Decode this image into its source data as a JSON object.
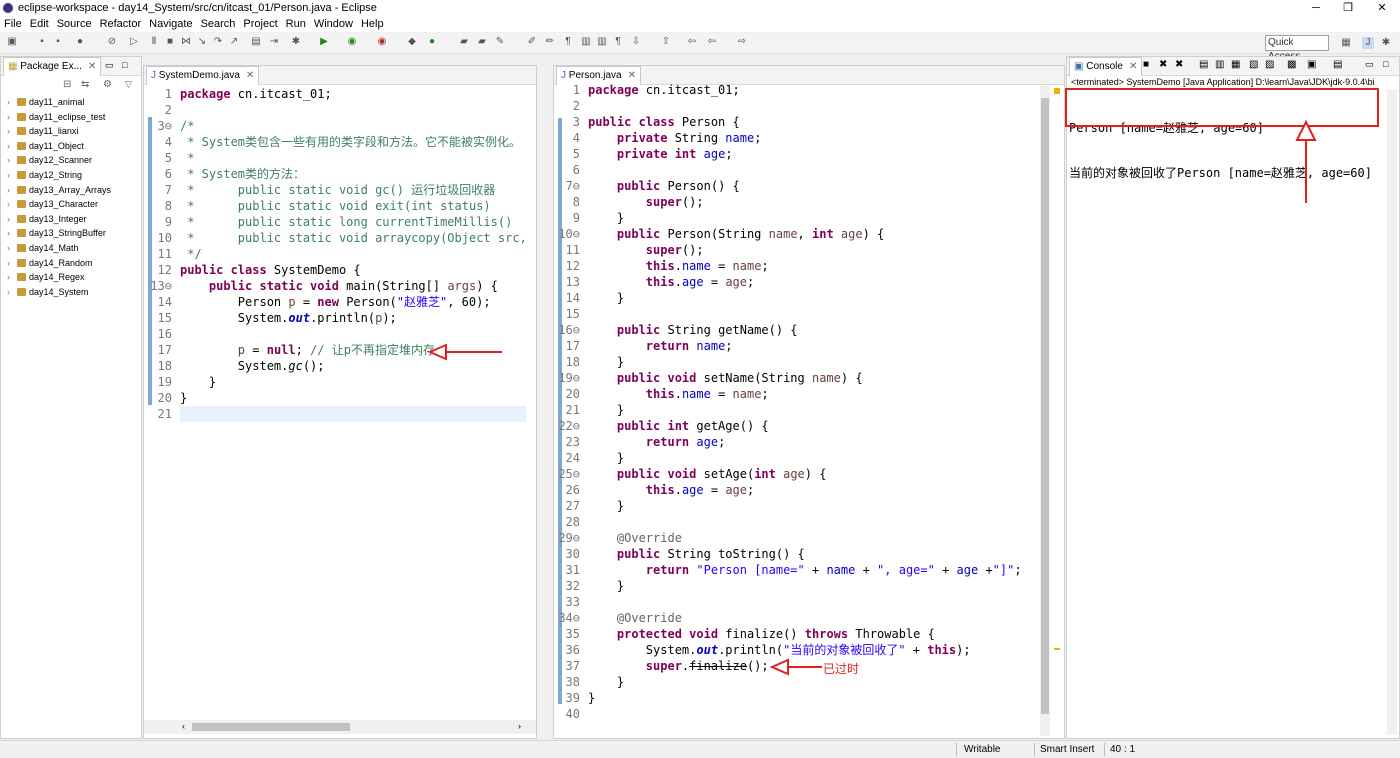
{
  "window": {
    "title": "eclipse-workspace - day14_System/src/cn/itcast_01/Person.java - Eclipse",
    "minimize": "─",
    "maximize": "❐",
    "close": "✕"
  },
  "menu": [
    "File",
    "Edit",
    "Source",
    "Refactor",
    "Navigate",
    "Search",
    "Project",
    "Run",
    "Window",
    "Help"
  ],
  "toolbar": {
    "quick_access_placeholder": "Quick Access"
  },
  "package_explorer": {
    "tab_label": "Package Ex...",
    "projects": [
      "day11_animal",
      "day11_eclipse_test",
      "day11_lianxi",
      "day11_Object",
      "day12_Scanner",
      "day12_String",
      "day13_Array_Arrays",
      "day13_Character",
      "day13_Integer",
      "day13_StringBuffer",
      "day14_Math",
      "day14_Random",
      "day14_Regex",
      "day14_System"
    ]
  },
  "editor_left": {
    "tab_label": "SystemDemo.java",
    "lines": [
      {
        "n": "1",
        "html": "<span class=\"kw\">package</span> cn.itcast_01;"
      },
      {
        "n": "2",
        "html": ""
      },
      {
        "n": "3⊖",
        "html": "<span class=\"cm\">/*</span>"
      },
      {
        "n": "4",
        "html": "<span class=\"cm\"> * System类包含一些有用的类字段和方法。它不能被实例化。</span>"
      },
      {
        "n": "5",
        "html": "<span class=\"cm\"> *</span>"
      },
      {
        "n": "6",
        "html": "<span class=\"cm\"> * System类的方法：</span>"
      },
      {
        "n": "7",
        "html": "<span class=\"cm\"> *      public static void gc() 运行垃圾回收器</span>"
      },
      {
        "n": "8",
        "html": "<span class=\"cm\"> *      public static void exit(int status)</span>"
      },
      {
        "n": "9",
        "html": "<span class=\"cm\"> *      public static long currentTimeMillis()</span>"
      },
      {
        "n": "10",
        "html": "<span class=\"cm\"> *      public static void arraycopy(Object src,</span>"
      },
      {
        "n": "11",
        "html": "<span class=\"cm\"> */</span>"
      },
      {
        "n": "12",
        "html": "<span class=\"kw\">public class</span> SystemDemo {"
      },
      {
        "n": "13⊖",
        "html": "    <span class=\"kw\">public static void</span> main(String[] <span class=\"pr\">args</span>) {"
      },
      {
        "n": "14",
        "html": "        Person <span class=\"pr\">p</span> = <span class=\"kw\">new</span> Person(<span class=\"st\">\"赵雅芝\"</span>, 60);"
      },
      {
        "n": "15",
        "html": "        System.<span class=\"sf\">out</span>.println(<span class=\"pr\">p</span>);"
      },
      {
        "n": "16",
        "html": ""
      },
      {
        "n": "17",
        "html": "        <span class=\"pr\">p</span> = <span class=\"kw\">null</span>; <span class=\"cm\">// 让p不再指定堆内存</span>"
      },
      {
        "n": "18",
        "html": "        System.<i>gc</i>();"
      },
      {
        "n": "19",
        "html": "    }"
      },
      {
        "n": "20",
        "html": "}"
      },
      {
        "n": "21",
        "html": ""
      }
    ]
  },
  "editor_right": {
    "tab_label": "Person.java",
    "annotation_label": "已过时",
    "lines": [
      {
        "n": "1",
        "html": "<span class=\"kw\">package</span> cn.itcast_01;"
      },
      {
        "n": "2",
        "html": ""
      },
      {
        "n": "3",
        "html": "<span class=\"kw\">public class</span> Person {"
      },
      {
        "n": "4",
        "html": "    <span class=\"kw\">private</span> String <span class=\"fd\">name</span>;"
      },
      {
        "n": "5",
        "html": "    <span class=\"kw\">private int</span> <span class=\"fd\">age</span>;"
      },
      {
        "n": "6",
        "html": ""
      },
      {
        "n": "7⊖",
        "html": "    <span class=\"kw\">public</span> Person() {"
      },
      {
        "n": "8",
        "html": "        <span class=\"kw\">super</span>();"
      },
      {
        "n": "9",
        "html": "    }"
      },
      {
        "n": "10⊖",
        "html": "    <span class=\"kw\">public</span> Person(String <span class=\"pr\">name</span>, <span class=\"kw\">int</span> <span class=\"pr\">age</span>) {"
      },
      {
        "n": "11",
        "html": "        <span class=\"kw\">super</span>();"
      },
      {
        "n": "12",
        "html": "        <span class=\"kw\">this</span>.<span class=\"fd\">name</span> = <span class=\"pr\">name</span>;"
      },
      {
        "n": "13",
        "html": "        <span class=\"kw\">this</span>.<span class=\"fd\">age</span> = <span class=\"pr\">age</span>;"
      },
      {
        "n": "14",
        "html": "    }"
      },
      {
        "n": "15",
        "html": ""
      },
      {
        "n": "16⊖",
        "html": "    <span class=\"kw\">public</span> String getName() {"
      },
      {
        "n": "17",
        "html": "        <span class=\"kw\">return</span> <span class=\"fd\">name</span>;"
      },
      {
        "n": "18",
        "html": "    }"
      },
      {
        "n": "19⊖",
        "html": "    <span class=\"kw\">public void</span> setName(String <span class=\"pr\">name</span>) {"
      },
      {
        "n": "20",
        "html": "        <span class=\"kw\">this</span>.<span class=\"fd\">name</span> = <span class=\"pr\">name</span>;"
      },
      {
        "n": "21",
        "html": "    }"
      },
      {
        "n": "22⊖",
        "html": "    <span class=\"kw\">public int</span> getAge() {"
      },
      {
        "n": "23",
        "html": "        <span class=\"kw\">return</span> <span class=\"fd\">age</span>;"
      },
      {
        "n": "24",
        "html": "    }"
      },
      {
        "n": "25⊖",
        "html": "    <span class=\"kw\">public void</span> setAge(<span class=\"kw\">int</span> <span class=\"pr\">age</span>) {"
      },
      {
        "n": "26",
        "html": "        <span class=\"kw\">this</span>.<span class=\"fd\">age</span> = <span class=\"pr\">age</span>;"
      },
      {
        "n": "27",
        "html": "    }"
      },
      {
        "n": "28",
        "html": ""
      },
      {
        "n": "29⊖",
        "html": "    <span class=\"an\">@Override</span>"
      },
      {
        "n": "30",
        "html": "    <span class=\"kw\">public</span> String toString() {"
      },
      {
        "n": "31",
        "html": "        <span class=\"kw\">return</span> <span class=\"st\">\"Person [name=\"</span> + <span class=\"fd\">name</span> + <span class=\"st\">\", age=\"</span> + <span class=\"fd\">age</span> +<span class=\"st\">\"]\"</span>;"
      },
      {
        "n": "32",
        "html": "    }"
      },
      {
        "n": "33",
        "html": ""
      },
      {
        "n": "34⊖",
        "html": "    <span class=\"an\">@Override</span>"
      },
      {
        "n": "35",
        "html": "    <span class=\"kw\">protected void</span> finalize() <span class=\"kw\">throws</span> Throwable {"
      },
      {
        "n": "36",
        "html": "        System.<span class=\"sf\">out</span>.println(<span class=\"st\">\"当前的对象被回收了\"</span> + <span class=\"kw\">this</span>);"
      },
      {
        "n": "37",
        "html": "        <span class=\"kw\">super</span>.<span class=\"depr\">finalize</span>();"
      },
      {
        "n": "38",
        "html": "    }"
      },
      {
        "n": "39",
        "html": "}"
      },
      {
        "n": "40",
        "html": ""
      }
    ]
  },
  "console": {
    "tab_label": "Console",
    "header": "<terminated> SystemDemo [Java Application] D:\\learn\\Java\\JDK\\jdk-9.0.4\\bi",
    "output": [
      "Person [name=赵雅芝, age=60]",
      "当前的对象被回收了Person [name=赵雅芝, age=60]"
    ]
  },
  "status_bar": {
    "writable": "Writable",
    "insert_mode": "Smart Insert",
    "position": "40 : 1"
  },
  "colors": {
    "annotation_red": "#e0201f",
    "fold_blue": "#7fa7d4",
    "current_line": "#e8f2fe"
  }
}
